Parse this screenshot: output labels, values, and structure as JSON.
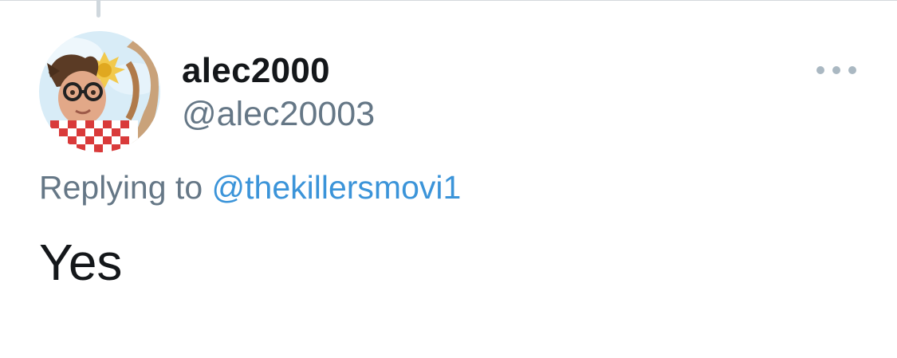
{
  "user": {
    "display_name": "alec2000",
    "handle": "@alec20003"
  },
  "reply": {
    "prefix": "Replying to",
    "target_handle": "@thekillersmovi1"
  },
  "tweet": {
    "text": "Yes"
  },
  "icons": {
    "more": "more-horizontal-icon",
    "avatar": "profile-avatar"
  },
  "colors": {
    "name_text": "#14171a",
    "secondary_text": "#657786",
    "link": "#3b94d9",
    "more_dots": "#aab8c2",
    "thread_line": "#cfd7dd"
  }
}
